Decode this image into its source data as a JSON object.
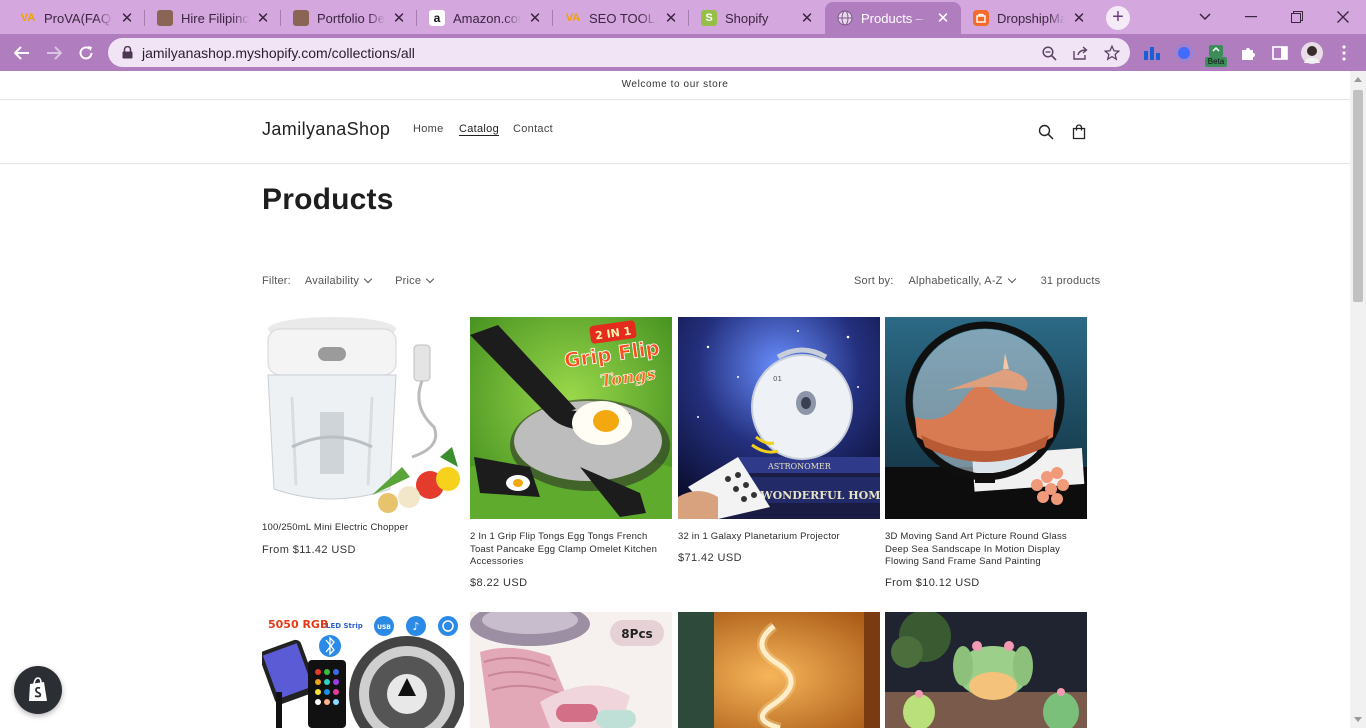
{
  "browser": {
    "tabs": [
      {
        "title": "ProVA(FAQ) -",
        "icon": "va-logo-icon",
        "active": false
      },
      {
        "title": "Hire Filipino V",
        "icon": "avatar-icon",
        "active": false
      },
      {
        "title": "Portfolio Deta",
        "icon": "avatar-icon",
        "active": false
      },
      {
        "title": "Amazon.com",
        "icon": "amazon-icon",
        "active": false
      },
      {
        "title": "SEO TOOLS |",
        "icon": "va-logo-icon",
        "active": false
      },
      {
        "title": "Shopify",
        "icon": "shopify-icon",
        "active": false
      },
      {
        "title": "Products – Ja",
        "icon": "globe-icon",
        "active": true
      },
      {
        "title": "DropshipMan",
        "icon": "dropshipman-icon",
        "active": false
      }
    ],
    "url": "jamilyanashop.myshopify.com/collections/all",
    "extension_badge": "Beta",
    "colors": {
      "frame": "#d4a7df",
      "toolbar": "#b07dbf",
      "omnibox": "#f1e4f5"
    }
  },
  "store": {
    "announcement": "Welcome to our store",
    "logo": "JamilyanaShop",
    "nav": [
      "Home",
      "Catalog",
      "Contact"
    ],
    "current_nav": "Catalog"
  },
  "collection": {
    "title": "Products",
    "filter_label": "Filter:",
    "filters": [
      "Availability",
      "Price"
    ],
    "sort_label": "Sort by:",
    "sort_value": "Alphabetically, A-Z",
    "count": "31 products"
  },
  "products": [
    {
      "name": "100/250mL Mini Electric Chopper",
      "price": "From $11.42 USD"
    },
    {
      "name": "2 In 1 Grip Flip Tongs Egg Tongs French Toast Pancake Egg Clamp Omelet Kitchen Accessories",
      "price": "$8.22 USD"
    },
    {
      "name": "32 in 1 Galaxy Planetarium Projector",
      "price": "$71.42 USD"
    },
    {
      "name": "3D Moving Sand Art Picture Round Glass Deep Sea Sandscape In Motion Display Flowing Sand Frame Sand Painting",
      "price": "From $10.12 USD"
    }
  ],
  "image_text": {
    "tongs_badge": "2 IN 1",
    "tongs_line1": "Grip Flip",
    "tongs_line2": "Tongs",
    "projector_lens": "01",
    "projector_book1": "ASTRONOMER",
    "projector_book2": "E WONDERFUL HOMELIFE",
    "led_title": "5050 RGB",
    "led_sub": "LED Strip",
    "led_usb": "USB",
    "towel_badge": "8Pcs"
  }
}
